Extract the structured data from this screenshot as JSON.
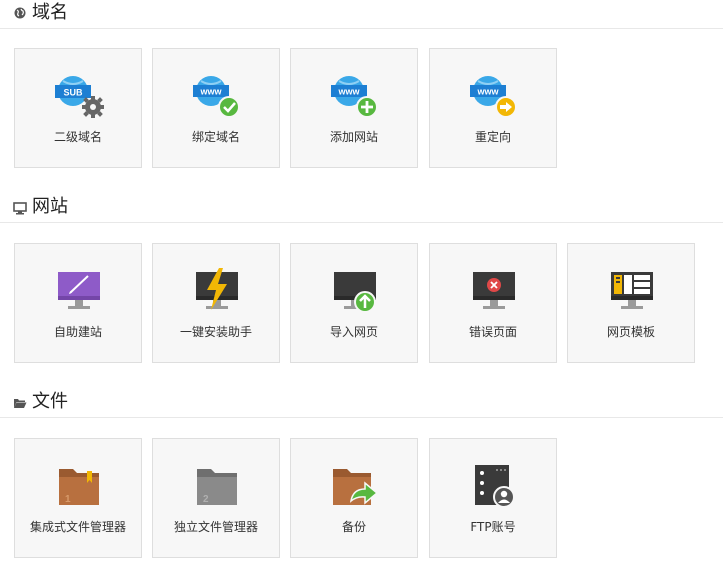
{
  "sections": [
    {
      "title": "域名",
      "icon": "globe-icon",
      "items": [
        {
          "label": "二级域名",
          "icon": "subdomain-globe-gear-icon",
          "badge": "SUB"
        },
        {
          "label": "绑定域名",
          "icon": "bind-domain-globe-check-icon",
          "badge": "www"
        },
        {
          "label": "添加网站",
          "icon": "add-site-globe-plus-icon",
          "badge": "www"
        },
        {
          "label": "重定向",
          "icon": "redirect-globe-arrow-icon",
          "badge": "www"
        }
      ]
    },
    {
      "title": "网站",
      "icon": "monitor-icon",
      "items": [
        {
          "label": "自助建站",
          "icon": "site-builder-brush-icon"
        },
        {
          "label": "一键安装助手",
          "icon": "one-click-install-lightning-icon"
        },
        {
          "label": "导入网页",
          "icon": "import-page-upload-icon"
        },
        {
          "label": "错误页面",
          "icon": "error-page-x-icon"
        },
        {
          "label": "网页模板",
          "icon": "page-template-icon"
        }
      ]
    },
    {
      "title": "文件",
      "icon": "folder-open-icon",
      "items": [
        {
          "label": "集成式文件管理器",
          "icon": "integrated-file-manager-folder-icon",
          "badge": "1"
        },
        {
          "label": "独立文件管理器",
          "icon": "standalone-file-manager-folder-icon",
          "badge": "2"
        },
        {
          "label": "备份",
          "icon": "backup-folder-arrow-icon"
        },
        {
          "label": "FTP账号",
          "icon": "ftp-account-server-user-icon"
        }
      ]
    }
  ],
  "colors": {
    "globe_blue": "#3aa8e8",
    "badge_blue": "#1d7fd3",
    "gear_gray": "#666666",
    "check_green": "#58b840",
    "arrow_yellow": "#f2b705",
    "purple": "#8e5bc8",
    "dark": "#333333",
    "error_red": "#e04848",
    "folder_brown": "#b8703f",
    "folder_gray": "#8a8a8a"
  }
}
